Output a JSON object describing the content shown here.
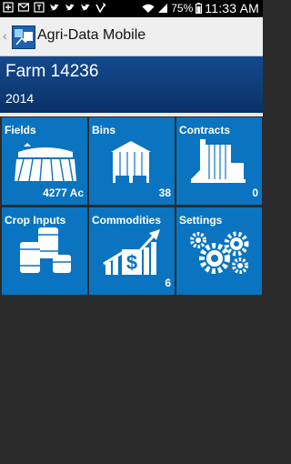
{
  "status_bar": {
    "battery": "75%",
    "time": "11:33 AM",
    "icons": [
      "add-icon",
      "mail-icon",
      "calendar-icon",
      "twitter-icon",
      "twitter-icon",
      "twitter-icon",
      "vine-icon",
      "wifi-icon",
      "signal-icon",
      "battery-icon"
    ]
  },
  "action_bar": {
    "title": "Agri-Data Mobile",
    "back_glyph": "‹"
  },
  "farm": {
    "name": "Farm 14236",
    "year": "2014"
  },
  "tiles": [
    {
      "label": "Fields",
      "value": "4277 Ac"
    },
    {
      "label": "Bins",
      "value": "38"
    },
    {
      "label": "Contracts",
      "value": "0"
    },
    {
      "label": "Crop Inputs",
      "value": ""
    },
    {
      "label": "Commodities",
      "value": "6"
    },
    {
      "label": "Settings",
      "value": ""
    }
  ],
  "colors": {
    "tile": "#0a74c0",
    "header": "#0e3d78",
    "background": "#2b2b2b"
  }
}
